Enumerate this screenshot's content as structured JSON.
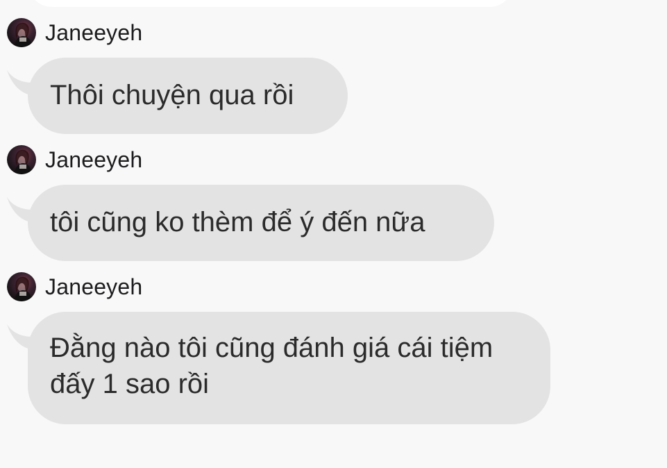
{
  "conversation": {
    "messages": [
      {
        "sender": "Janeeyeh",
        "text": "Thôi chuyện qua rồi"
      },
      {
        "sender": "Janeeyeh",
        "text": "tôi cũng ko thèm để ý đến nữa"
      },
      {
        "sender": "Janeeyeh",
        "text": "Đằng nào tôi cũng đánh giá cái tiệm đấy 1 sao rồi"
      }
    ]
  },
  "icons": {
    "avatar": "user-avatar-photo",
    "bubble_tail": "speech-bubble-tail"
  },
  "colors": {
    "background": "#f8f8f8",
    "bubble": "#e3e3e3",
    "text": "#1c1c1e"
  }
}
